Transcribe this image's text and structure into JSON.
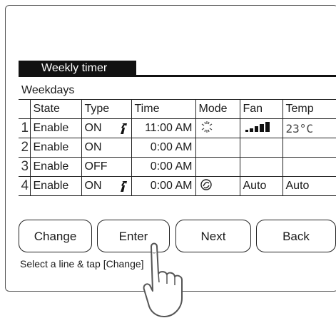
{
  "screen": {
    "title": "Weekly timer",
    "section_label": "Weekdays",
    "hint": "Select a line & tap [Change]"
  },
  "table": {
    "headers": [
      "",
      "State",
      "Type",
      "Time",
      "Mode",
      "Fan",
      "Temp"
    ],
    "rows": [
      {
        "num": "1",
        "state": "Enable",
        "type": "ON",
        "type_icon": "arrow-icon",
        "time": "11:00  AM",
        "mode_icon": "snowflake-icon",
        "fan_icon": "fan-level-bars-icon",
        "fan": "",
        "temp": "23°C"
      },
      {
        "num": "2",
        "state": "Enable",
        "type": "ON",
        "type_icon": "",
        "time": "0:00  AM",
        "mode_icon": "",
        "fan_icon": "",
        "fan": "",
        "temp": ""
      },
      {
        "num": "3",
        "state": "Enable",
        "type": "OFF",
        "type_icon": "",
        "time": "0:00  AM",
        "mode_icon": "",
        "fan_icon": "",
        "fan": "",
        "temp": ""
      },
      {
        "num": "4",
        "state": "Enable",
        "type": "ON",
        "type_icon": "arrow-icon",
        "time": "0:00  AM",
        "mode_icon": "auto-mode-icon",
        "fan_icon": "",
        "fan": "Auto",
        "temp": "Auto"
      }
    ]
  },
  "buttons": {
    "change": "Change",
    "enter": "Enter",
    "next": "Next",
    "back": "Back"
  },
  "colors": {
    "foreground": "#1a1a1a",
    "title_tab_bg": "#111111"
  }
}
